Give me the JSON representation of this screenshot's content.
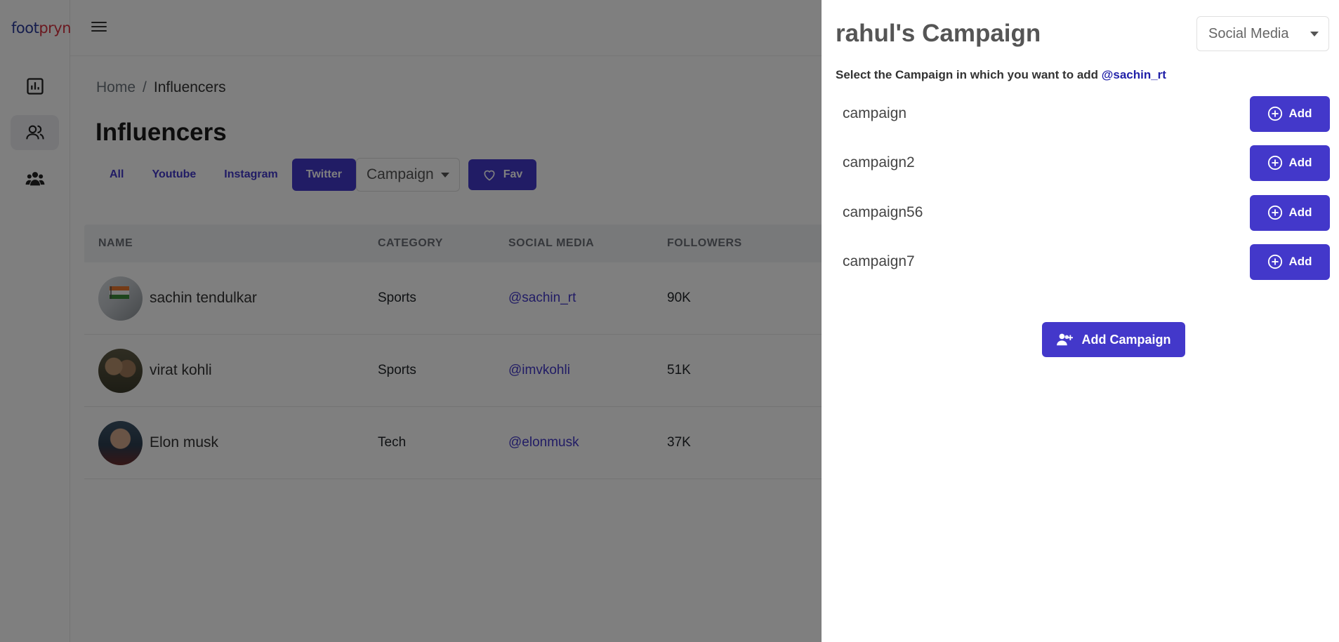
{
  "app": {
    "logo": {
      "part1": "foot",
      "part2": "prynt"
    }
  },
  "sidebar": {
    "items": [
      {
        "icon": "chart-icon"
      },
      {
        "icon": "users-icon",
        "active": true
      },
      {
        "icon": "group-icon"
      }
    ]
  },
  "breadcrumb": {
    "home": "Home",
    "separator": "/",
    "current": "Influencers"
  },
  "page": {
    "title": "Influencers"
  },
  "filters": {
    "tabs": [
      "All",
      "Youtube",
      "Instagram",
      "Twitter"
    ],
    "active": "Twitter",
    "campaign_select": "Campaign",
    "fav_label": "Fav"
  },
  "table": {
    "headers": [
      "NAME",
      "CATEGORY",
      "SOCIAL MEDIA",
      "FOLLOWERS"
    ],
    "rows": [
      {
        "name": "sachin tendulkar",
        "category": "Sports",
        "handle": "@sachin_rt",
        "followers": "90K"
      },
      {
        "name": "virat kohli",
        "category": "Sports",
        "handle": "@imvkohli",
        "followers": "51K"
      },
      {
        "name": "Elon musk",
        "category": "Tech",
        "handle": "@elonmusk",
        "followers": "37K"
      }
    ]
  },
  "drawer": {
    "title": "rahul's Campaign",
    "social_select": "Social Media",
    "instruction_prefix": "Select the Campaign in which you want to add",
    "instruction_handle": "@sachin_rt",
    "campaigns": [
      {
        "name": "campaign",
        "button": "Add"
      },
      {
        "name": "campaign2",
        "button": "Add"
      },
      {
        "name": "campaign56",
        "button": "Add"
      },
      {
        "name": "campaign7",
        "button": "Add"
      }
    ],
    "add_campaign_label": "Add Campaign"
  },
  "colors": {
    "primary": "#4338ca",
    "overlay": "rgba(0,0,0,0.5)"
  }
}
